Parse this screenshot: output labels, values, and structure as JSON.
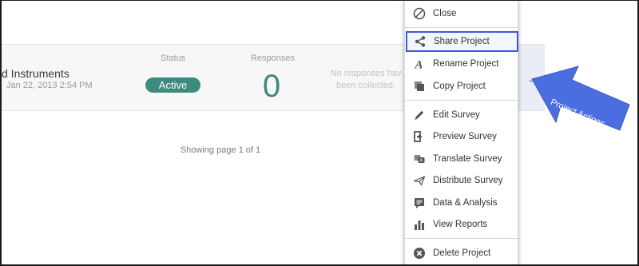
{
  "project": {
    "name": "d Instruments",
    "date": "Jan 22, 2013 2:54 PM",
    "status_label": "Status",
    "status_value": "Active",
    "responses_label": "Responses",
    "responses_count": "0",
    "no_responses_line1": "No responses hav",
    "no_responses_line2": "been collected.",
    "chevron": "⌄"
  },
  "pagination": {
    "text": "Showing page 1 of 1"
  },
  "menu": {
    "items": [
      {
        "label": "Close",
        "icon": "close-circle-icon"
      },
      {
        "label": "Share Project",
        "icon": "share-icon",
        "highlighted": true
      },
      {
        "label": "Rename Project",
        "icon": "rename-icon"
      },
      {
        "label": "Copy Project",
        "icon": "copy-icon"
      },
      {
        "label": "Edit Survey",
        "icon": "pencil-icon"
      },
      {
        "label": "Preview Survey",
        "icon": "preview-icon"
      },
      {
        "label": "Translate Survey",
        "icon": "translate-icon"
      },
      {
        "label": "Distribute Survey",
        "icon": "paper-plane-icon"
      },
      {
        "label": "Data & Analysis",
        "icon": "data-icon"
      },
      {
        "label": "View Reports",
        "icon": "bar-chart-icon"
      },
      {
        "label": "Delete Project",
        "icon": "delete-circle-icon"
      }
    ]
  },
  "callout": {
    "label": "Project Actions",
    "color": "#4a6ee0"
  },
  "colors": {
    "accent": "#3d8a7f",
    "highlight_border": "#3b5bdb"
  }
}
